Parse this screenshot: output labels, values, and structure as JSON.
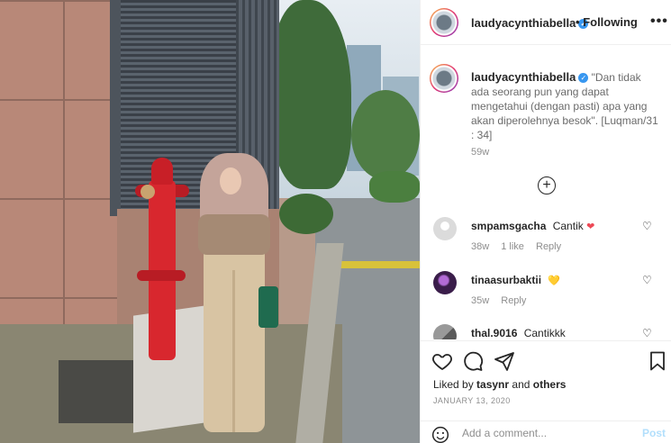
{
  "post": {
    "username": "laudyacynthiabella",
    "verified_mark": "✓",
    "separator": "•",
    "follow_status": "Following",
    "more_icon": "more-options-icon"
  },
  "caption": {
    "username": "laudyacynthiabella",
    "text": "\"Dan tidak ada seorang pun yang dapat mengetahui (dengan pasti) apa yang akan diperolehnya besok\". [Luqman/31 : 34]",
    "time": "59w",
    "load_more_icon": "+"
  },
  "comments": [
    {
      "user": "smpamsgacha",
      "text": "Cantik",
      "emoji": "❤",
      "emoji_color": "#ed4956",
      "time": "38w",
      "likes": "1 like",
      "reply": "Reply"
    },
    {
      "user": "tinaasurbaktii",
      "text": "",
      "emoji": "💛",
      "emoji_color": "#f3d22b",
      "time": "35w",
      "likes": "",
      "reply": "Reply"
    },
    {
      "user": "thal.9016",
      "text": "Cantikkk",
      "emoji": "",
      "emoji_color": "",
      "time": "",
      "likes": "",
      "reply": ""
    }
  ],
  "actions": {
    "liked_by_prefix": "Liked by ",
    "liked_by_user": "tasynr",
    "liked_by_and": " and ",
    "liked_by_others": "others",
    "date": "JANUARY 13, 2020"
  },
  "composer": {
    "placeholder": "Add a comment...",
    "post_label": "Post"
  },
  "colors": {
    "verified": "#3897f0",
    "heart": "#ed4956",
    "post_disabled": "#b2dffc"
  }
}
